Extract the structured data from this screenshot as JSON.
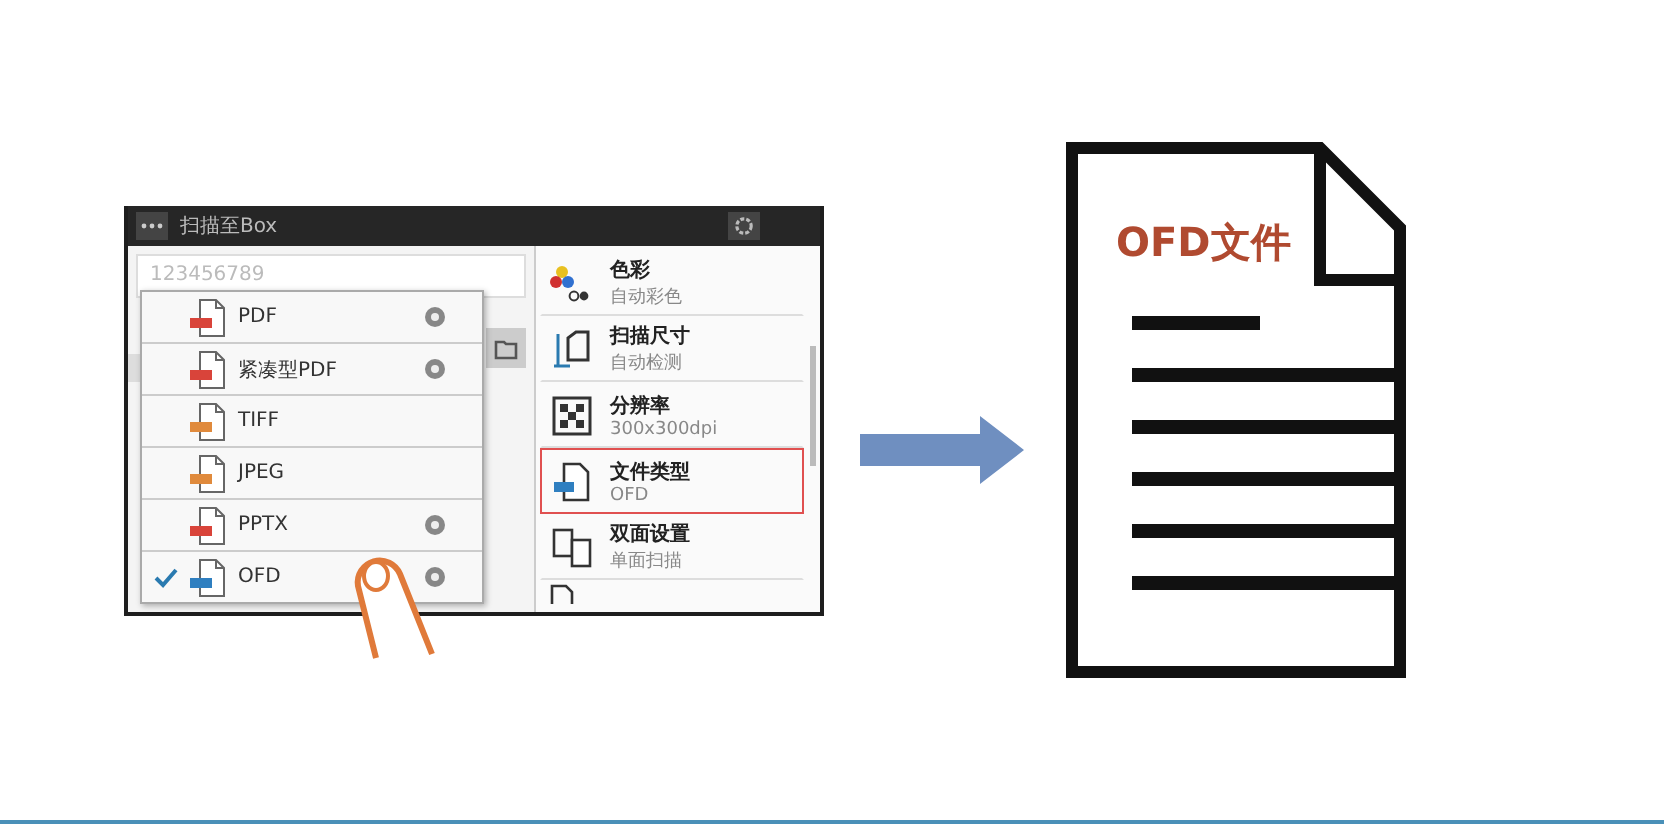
{
  "window": {
    "title": "扫描至Box"
  },
  "field": {
    "value": "123456789"
  },
  "format_menu": [
    {
      "label": "PDF",
      "color": "#d9443a",
      "settings": true,
      "selected": false
    },
    {
      "label": "紧凑型PDF",
      "color": "#d9443a",
      "settings": true,
      "selected": false
    },
    {
      "label": "TIFF",
      "color": "#e08a3c",
      "settings": false,
      "selected": false
    },
    {
      "label": "JPEG",
      "color": "#e08a3c",
      "settings": false,
      "selected": false
    },
    {
      "label": "PPTX",
      "color": "#d9443a",
      "settings": true,
      "selected": false
    },
    {
      "label": "OFD",
      "color": "#2f7fc0",
      "settings": true,
      "selected": true
    }
  ],
  "settings_list": [
    {
      "kind": "color",
      "title": "色彩",
      "value": "自动彩色",
      "selected": false
    },
    {
      "kind": "size",
      "title": "扫描尺寸",
      "value": "自动检测",
      "selected": false
    },
    {
      "kind": "resolution",
      "title": "分辨率",
      "value": "300x300dpi",
      "selected": false
    },
    {
      "kind": "file-type",
      "title": "文件类型",
      "value": "OFD",
      "selected": true
    },
    {
      "kind": "duplex",
      "title": "双面设置",
      "value": "单面扫描",
      "selected": false
    }
  ],
  "document": {
    "title": "OFD文件"
  }
}
